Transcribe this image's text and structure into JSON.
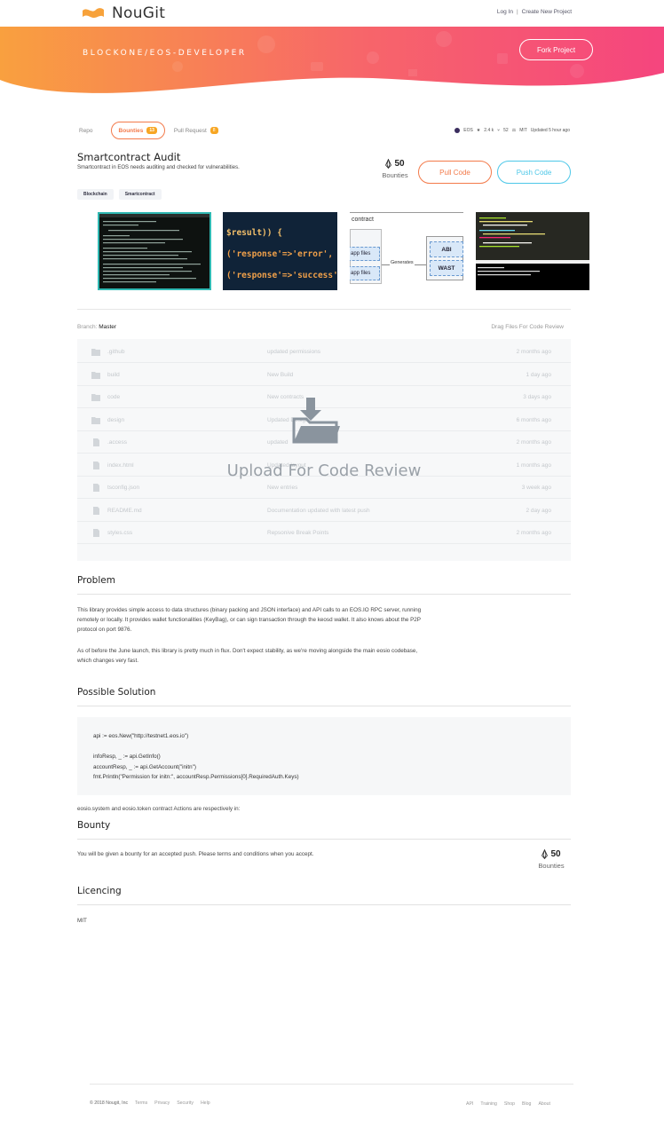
{
  "brand": {
    "name": "NouGit"
  },
  "topnav": {
    "login": "Log In",
    "separator": "|",
    "create": "Create New Project"
  },
  "hero": {
    "title": "BLOCKONE/EOS-DEVELOPER",
    "fork_label": "Fork Project"
  },
  "tabs": [
    {
      "label": "Repo",
      "count": ""
    },
    {
      "label": "Bounties",
      "count": "13"
    },
    {
      "label": "Pull Request",
      "count": "8"
    }
  ],
  "meta": {
    "lang": "EOS",
    "stars": "2.4 k",
    "forks": "52",
    "license": "MIT",
    "updated": "Updated 5 hour ago"
  },
  "project": {
    "title": "Smartcontract Audit",
    "description": "Smartcontract in EOS needs auditing and checked for vulnerabilities.",
    "tags": [
      "Blockchain",
      "Smartcontract"
    ],
    "bounty_value": "50",
    "bounty_label": "Bounties",
    "pull_label": "Pull Code",
    "push_label": "Push Code"
  },
  "gallery": {
    "code2_line1": "$result)) {",
    "code2_line2": "('response'=>'error', 'mes",
    "code2_line3": "('response'=>'success');",
    "diagram_title": "contract",
    "diagram_app1": "app files",
    "diagram_app2": "app files",
    "diagram_generates": "Generates",
    "diagram_abi": "ABI",
    "diagram_wast": "WAST"
  },
  "repo": {
    "branch_label": "Branch:",
    "branch_value": "Master",
    "drag_label": "Drag Files For Code Review",
    "upload_text": "Upload For Code Review",
    "files": [
      {
        "type": "folder",
        "name": ".github",
        "message": "updated permissions",
        "time": "2 months ago"
      },
      {
        "type": "folder",
        "name": "build",
        "message": "New Build",
        "time": "1 day ago"
      },
      {
        "type": "folder",
        "name": "code",
        "message": "New contracts",
        "time": "3 days ago"
      },
      {
        "type": "folder",
        "name": "design",
        "message": "Updated Design",
        "time": "6 months ago"
      },
      {
        "type": "file",
        "name": ".access",
        "message": "updated",
        "time": "2 months ago"
      },
      {
        "type": "file",
        "name": "index.html",
        "message": "Updated layout",
        "time": "1 months ago"
      },
      {
        "type": "file",
        "name": "tsconfig.json",
        "message": "New entries",
        "time": "3 week ago"
      },
      {
        "type": "file",
        "name": "README.md",
        "message": "Documentation updated with latest push",
        "time": "2 day ago"
      },
      {
        "type": "file",
        "name": "styles.css",
        "message": "Repsonive Break Points",
        "time": "2 months ago"
      }
    ]
  },
  "problem": {
    "heading": "Problem",
    "p1": "This library provides simple access to data structures (binary packing and JSON interface) and API calls to an EOS.IO RPC server, running remotely or locally. It provides wallet functionalities (KeyBag), or can sign transaction through the keosd wallet. It also knows about the P2P protocol on port 9876.",
    "p2": "As of before the June launch, this library is pretty much in flux. Don't expect stability, as we're moving alongside the main eosio codebase, which changes very fast."
  },
  "solution": {
    "heading": "Possible Solution",
    "code": [
      "api := eos.New(\"http://testnet1.eos.io\")",
      "",
      "infoResp, _ := api.GetInfo()",
      "accountResp, _ := api.GetAccount(\"initn\")",
      "fmt.Println(\"Permission for initn:\", accountResp.Permissions[0].RequiredAuth.Keys)"
    ],
    "after": "eosio.system and eosio.token contract Actions are respectively in:"
  },
  "bounty": {
    "heading": "Bounty",
    "text": "You will be given a bounty for an accepted push. Please terms and conditions when you accept.",
    "value": "50",
    "label": "Bounties"
  },
  "licencing": {
    "heading": "Licencing",
    "value": "MIT"
  },
  "footer": {
    "copyright": "© 2018 Nougit, Inc",
    "left_links": [
      "Terms",
      "Privacy",
      "Security",
      "Help"
    ],
    "right_links": [
      "API",
      "Training",
      "Shop",
      "Blog",
      "About"
    ]
  },
  "colors": {
    "accent_orange": "#f37a4a",
    "accent_cyan": "#4cc7e8",
    "hero_start": "#f9a03f",
    "hero_end": "#f5457e"
  }
}
